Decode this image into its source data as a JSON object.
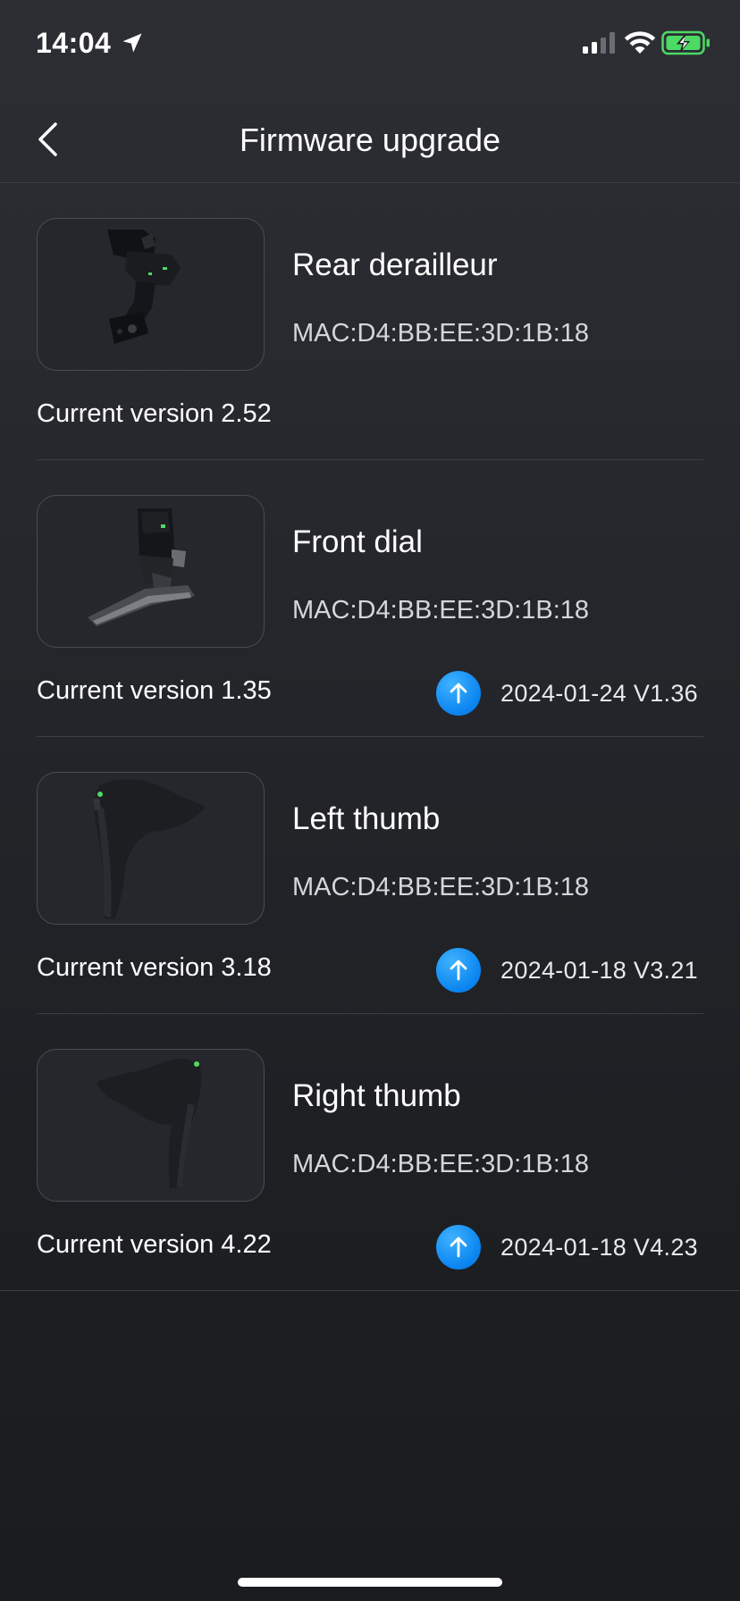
{
  "status_bar": {
    "time": "14:04"
  },
  "nav": {
    "title": "Firmware upgrade"
  },
  "devices": [
    {
      "name": "Rear derailleur",
      "mac": "MAC:D4:BB:EE:3D:1B:18",
      "current_version": "Current version 2.52",
      "update": null
    },
    {
      "name": "Front dial",
      "mac": "MAC:D4:BB:EE:3D:1B:18",
      "current_version": "Current version 1.35",
      "update": "2024-01-24 V1.36"
    },
    {
      "name": "Left thumb",
      "mac": "MAC:D4:BB:EE:3D:1B:18",
      "current_version": "Current version 3.18",
      "update": "2024-01-18 V3.21"
    },
    {
      "name": "Right thumb",
      "mac": "MAC:D4:BB:EE:3D:1B:18",
      "current_version": "Current version 4.22",
      "update": "2024-01-18 V4.23"
    }
  ],
  "colors": {
    "background": "#24262b",
    "accent_blue": "#0a84f0",
    "battery_green": "#4cd964",
    "divider": "#3c3e44"
  },
  "icons": {
    "back": "chevron-left-icon",
    "update": "arrow-up-icon",
    "location": "location-arrow-icon",
    "signal": "cellular-signal-icon",
    "wifi": "wifi-icon",
    "battery": "battery-charging-icon"
  }
}
